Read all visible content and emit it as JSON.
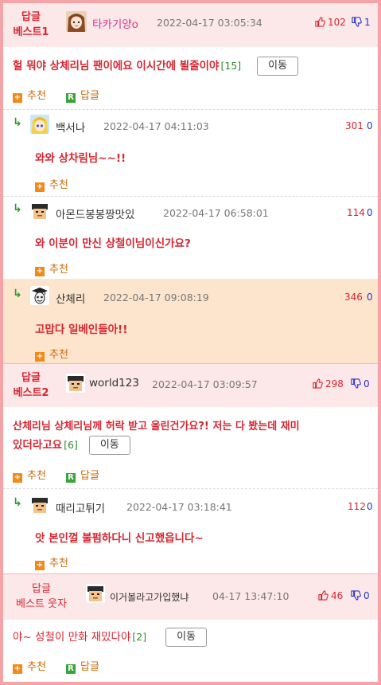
{
  "labels": {
    "reply": "답글",
    "best1": "베스트1",
    "best2": "베스트2",
    "best_funny": "베스트 웃자",
    "recommend": "추천",
    "reply_btn": "답글",
    "move": "이동"
  },
  "best1": {
    "nick": "타카기양o",
    "date": "2022-04-17 03:05:34",
    "up": "102",
    "down": "1",
    "text": "헐 뭐야 상체리님 팬이에요 이시간에 뵐줄이야",
    "count": "[15]",
    "replies": [
      {
        "nick": "백서나",
        "date": "2022-04-17 04:11:03",
        "up": "301",
        "down": "0",
        "text": "와와 상차림님~~!!"
      },
      {
        "nick": "아몬드봉봉짱맛있",
        "date": "2022-04-17 06:58:01",
        "up": "114",
        "down": "0",
        "text": "와 이분이 만신 상철이님이신가요?"
      },
      {
        "nick": "산체리",
        "date": "2022-04-17 09:08:19",
        "up": "346",
        "down": "0",
        "text": "고맙다 일베인들아!!"
      }
    ]
  },
  "best2": {
    "nick": "world123",
    "date": "2022-04-17 03:09:57",
    "up": "298",
    "down": "0",
    "text_line1": "산체리님 상체리님께 허락 받고 올린건가요?! 저는 다 봤는데 재미",
    "text_line2": "있더라고요",
    "count": "[6]",
    "replies": [
      {
        "nick": "때리고튀기",
        "date": "2022-04-17 03:18:41",
        "up": "112",
        "down": "0",
        "text": "앗 본인껄 불펌하다니 신고했읍니다~"
      }
    ]
  },
  "best3": {
    "nick": "이거볼라고가입했냐",
    "date": "04-17 13:47:10",
    "up": "46",
    "down": "0",
    "text": "야~ 성철이 만화 재밌다야",
    "count": "[2]"
  },
  "colors": {
    "border": "#f4a3a6",
    "accent": "#d72631",
    "best_bg": "#fde8e9",
    "highlight_bg": "#fde4cc"
  }
}
